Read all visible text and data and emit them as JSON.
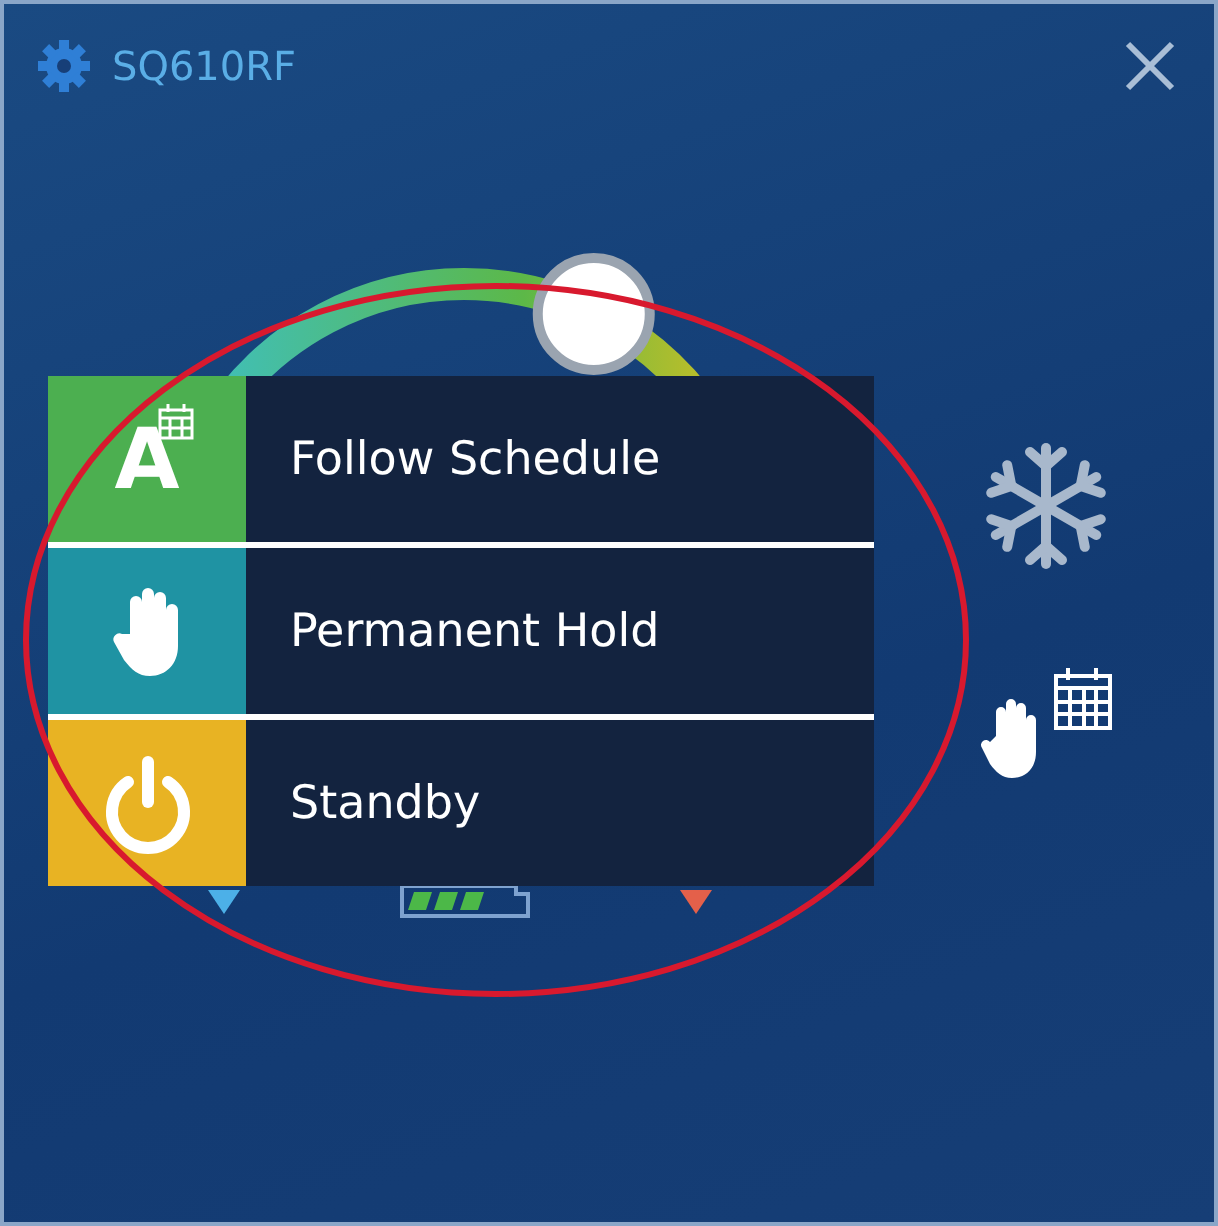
{
  "window": {
    "title": "SQ610RF"
  },
  "mode_menu": [
    {
      "kind": "schedule",
      "label": "Follow Schedule",
      "icon_text": "A"
    },
    {
      "kind": "hold",
      "label": "Permanent Hold"
    },
    {
      "kind": "standby",
      "label": "Standby"
    }
  ]
}
